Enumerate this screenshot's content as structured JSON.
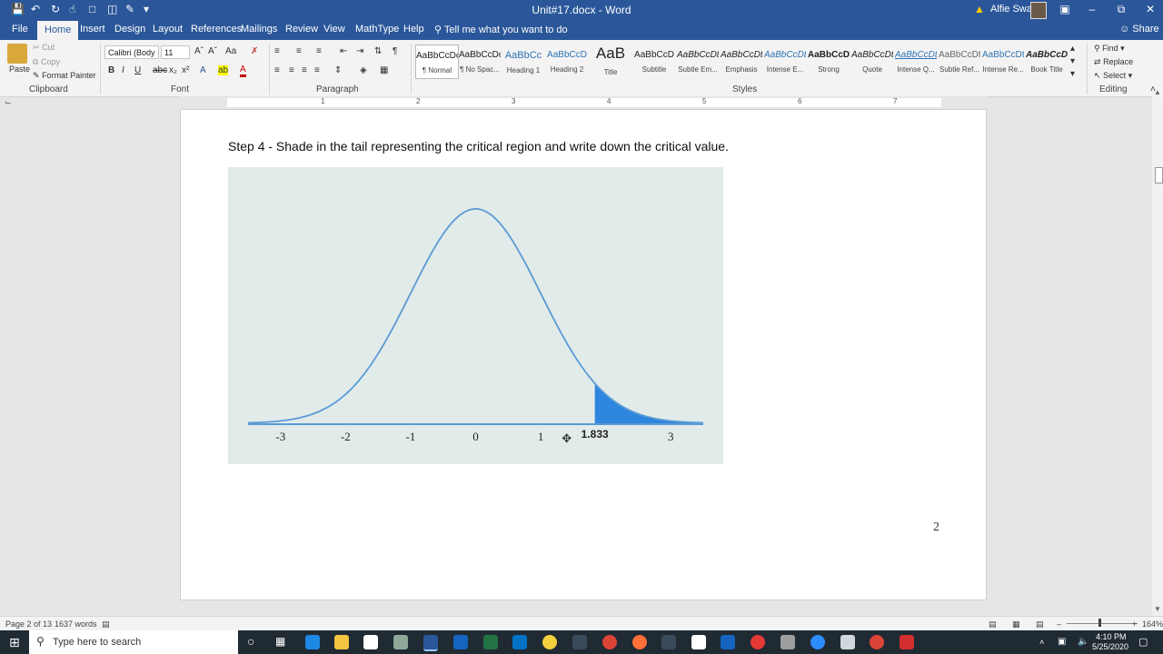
{
  "window": {
    "title": "Unit#17.docx  -  Word",
    "user": "Alfie Swan"
  },
  "tabs": [
    "File",
    "Home",
    "Insert",
    "Design",
    "Layout",
    "References",
    "Mailings",
    "Review",
    "View",
    "MathType",
    "Help"
  ],
  "tell_me": "Tell me what you want to do",
  "share": "Share",
  "clipboard": {
    "paste": "Paste",
    "cut": "Cut",
    "copy": "Copy",
    "format_painter": "Format Painter",
    "label": "Clipboard"
  },
  "font": {
    "name": "Calibri (Body",
    "size": "11",
    "label": "Font"
  },
  "paragraph": {
    "label": "Paragraph"
  },
  "styles": {
    "label": "Styles",
    "items": [
      {
        "preview": "AaBbCcDc",
        "name": "¶ Normal"
      },
      {
        "preview": "AaBbCcDc",
        "name": "¶ No Spac..."
      },
      {
        "preview": "AaBbCc",
        "name": "Heading 1"
      },
      {
        "preview": "AaBbCcD",
        "name": "Heading 2"
      },
      {
        "preview": "AaB",
        "name": "Title"
      },
      {
        "preview": "AaBbCcD",
        "name": "Subtitle"
      },
      {
        "preview": "AaBbCcDt",
        "name": "Subtle Em..."
      },
      {
        "preview": "AaBbCcDt",
        "name": "Emphasis"
      },
      {
        "preview": "AaBbCcDt",
        "name": "Intense E..."
      },
      {
        "preview": "AaBbCcDt",
        "name": "Strong"
      },
      {
        "preview": "AaBbCcDt",
        "name": "Quote"
      },
      {
        "preview": "AaBbCcDt",
        "name": "Intense Q..."
      },
      {
        "preview": "AaBbCcDt",
        "name": "Subtle Ref..."
      },
      {
        "preview": "AaBbCcDt",
        "name": "Intense Re..."
      },
      {
        "preview": "AaBbCcDt",
        "name": "Book Title"
      }
    ]
  },
  "editing": {
    "find": "Find",
    "replace": "Replace",
    "select": "Select",
    "label": "Editing"
  },
  "ruler_numbers": [
    "1",
    "1",
    "2",
    "3",
    "4",
    "5",
    "6",
    "7"
  ],
  "document": {
    "step_text": "Step 4 - Shade in the tail representing the critical region and write down the critical value.",
    "page_number": "2"
  },
  "chart_data": {
    "type": "area",
    "distribution": "standard normal curve",
    "x_ticks": [
      "-3",
      "-2",
      "-1",
      "0",
      "1",
      "1.833",
      "3"
    ],
    "xlim": [
      -3.5,
      3.5
    ],
    "shaded_region": {
      "from": 1.833,
      "to": 3.5
    },
    "critical_value": "1.833",
    "colors": {
      "curve": "#5b9bd5",
      "shade": "#2e86de",
      "background": "#e1ebea"
    }
  },
  "statusbar": {
    "page": "Page 2 of 13",
    "words": "1637 words",
    "zoom": "164%"
  },
  "taskbar": {
    "search_placeholder": "Type here to search",
    "time": "4:10 PM",
    "date": "5/25/2020"
  }
}
